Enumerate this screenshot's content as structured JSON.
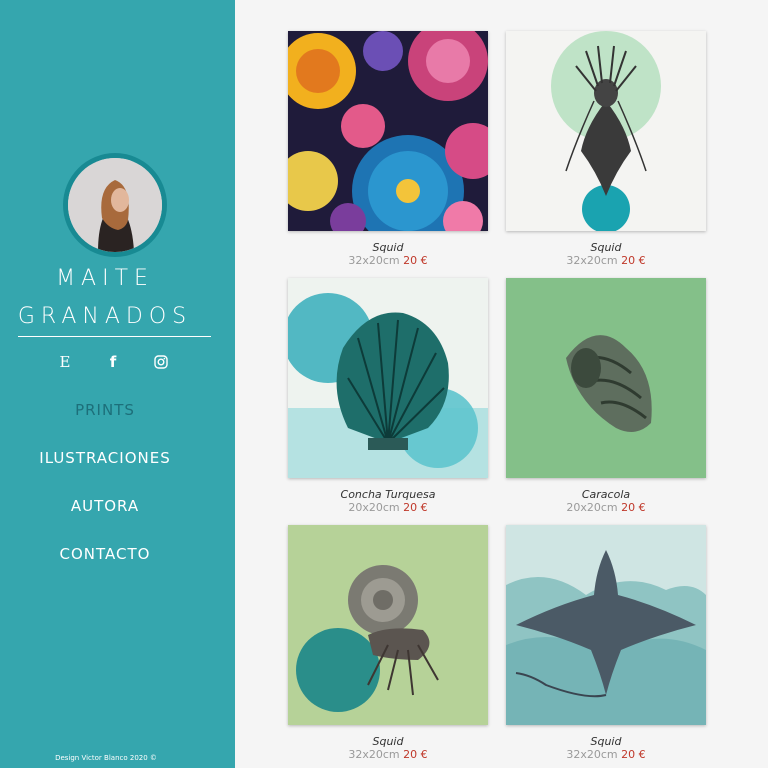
{
  "brand": {
    "first_name": "MAITE",
    "last_name": "GRANADOS",
    "accent_color": "#35a6ae"
  },
  "social": [
    {
      "icon": "etsy-icon",
      "glyph": "E"
    },
    {
      "icon": "facebook-icon",
      "glyph": "f"
    },
    {
      "icon": "instagram-icon",
      "glyph": "◎"
    }
  ],
  "nav": {
    "prints": "PRINTS",
    "ilustraciones": "ILUSTRACIONES",
    "autora": "AUTORA",
    "contacto": "CONTACTO"
  },
  "footer": "Design Victor Blanco 2020 ©",
  "products": [
    {
      "title": "Squid",
      "size": "32x20cm",
      "price": "20 €"
    },
    {
      "title": "Squid",
      "size": "32x20cm",
      "price": "20 €"
    },
    {
      "title": "Concha Turquesa",
      "size": "20x20cm",
      "price": "20 €"
    },
    {
      "title": "Caracola",
      "size": "20x20cm",
      "price": "20 €"
    },
    {
      "title": "Squid",
      "size": "32x20cm",
      "price": "20 €"
    },
    {
      "title": "Squid",
      "size": "32x20cm",
      "price": "20 €"
    }
  ]
}
